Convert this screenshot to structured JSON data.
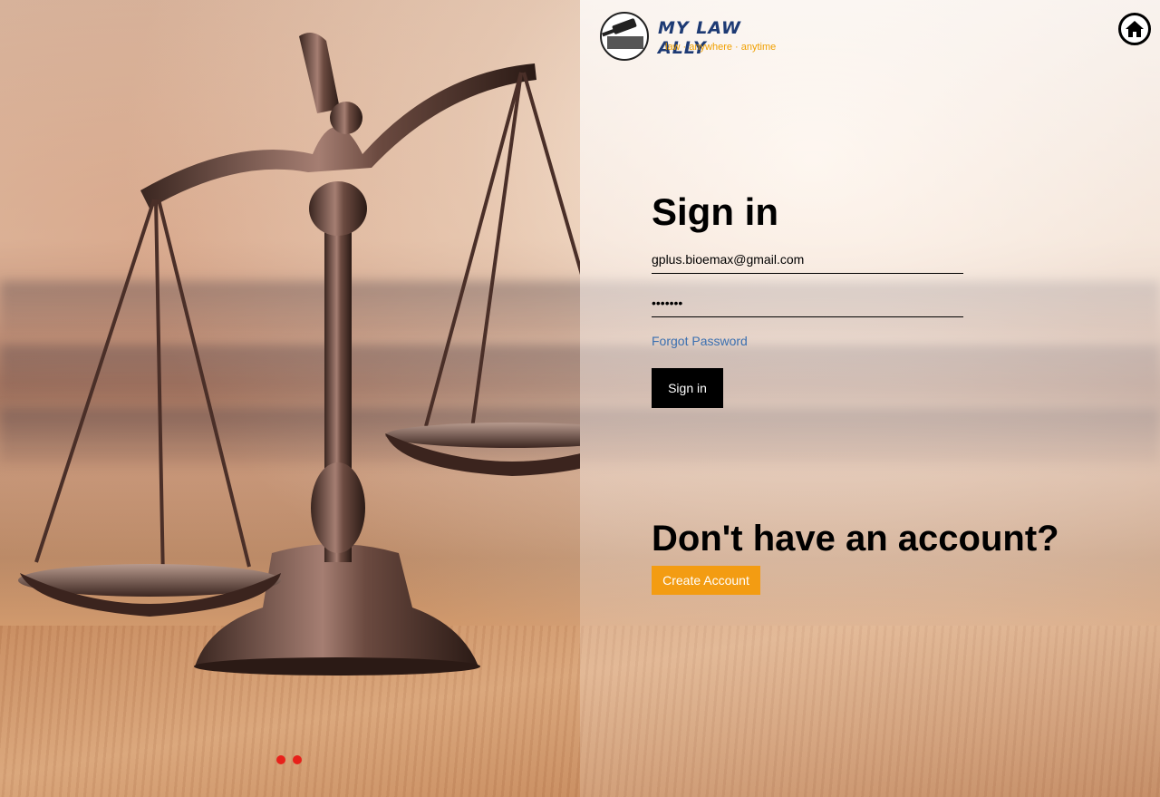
{
  "logo": {
    "title": "MY LAW ALLY",
    "tagline": "law · anywhere · anytime",
    "icon": "gavel-book-icon",
    "title_color": "#1d3a74",
    "tagline_color": "#f0a000"
  },
  "header": {
    "home_icon": "home-icon"
  },
  "form": {
    "title": "Sign in",
    "email_value": "gplus.bioemax@gmail.com",
    "password_value": "•••••••",
    "forgot_label": "Forgot Password",
    "signin_label": "Sign in"
  },
  "signup": {
    "prompt": "Don't have an account?",
    "create_label": "Create Account",
    "button_color": "#f39c12"
  },
  "carousel": {
    "dots": 2,
    "dot_color": "#e8201a"
  }
}
